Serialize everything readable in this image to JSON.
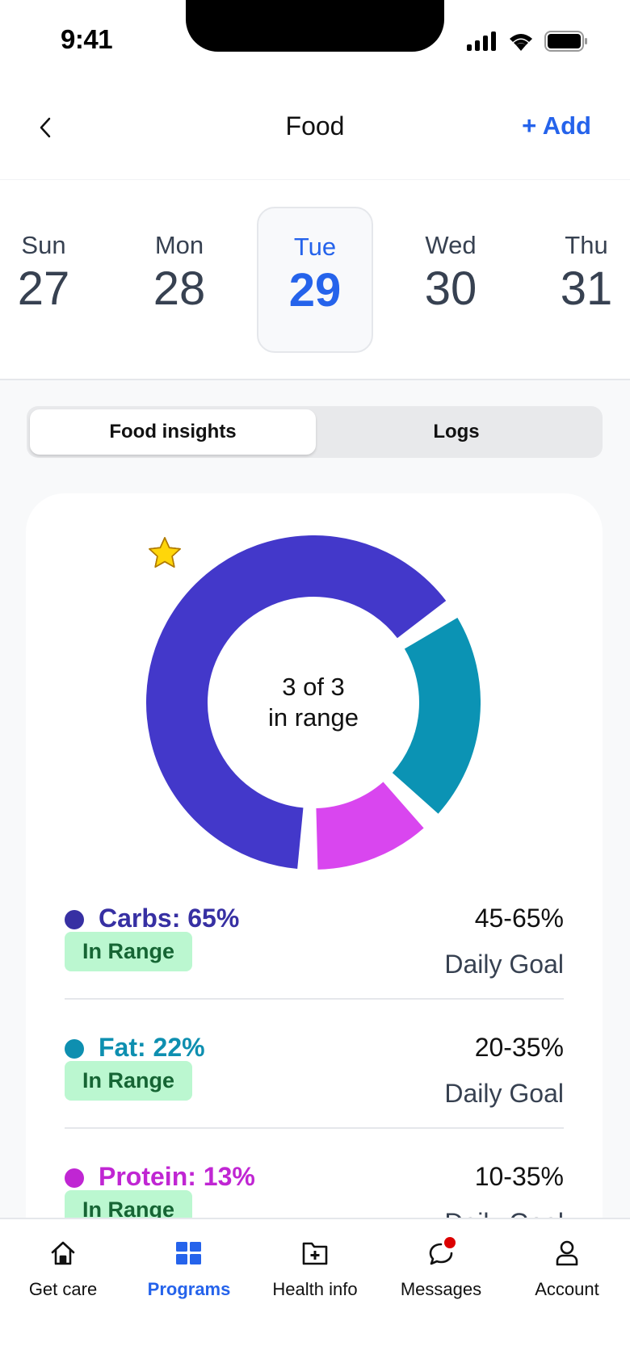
{
  "status_bar": {
    "time": "9:41"
  },
  "header": {
    "title": "Food",
    "add_label": "+ Add",
    "back_icon": "chevron-left-icon"
  },
  "dates": [
    {
      "day": "Sun",
      "num": "27",
      "selected": false
    },
    {
      "day": "Mon",
      "num": "28",
      "selected": false
    },
    {
      "day": "Tue",
      "num": "29",
      "selected": true
    },
    {
      "day": "Wed",
      "num": "30",
      "selected": false
    },
    {
      "day": "Thu",
      "num": "31",
      "selected": false
    }
  ],
  "segments": [
    {
      "label": "Food insights",
      "active": true
    },
    {
      "label": "Logs",
      "active": false
    }
  ],
  "summary": {
    "stars_filled": 3,
    "stars_total": 3,
    "line1": "3 of 3",
    "line2": "in range"
  },
  "macros": [
    {
      "name": "Carbs",
      "label": "Carbs: 65%",
      "percent": 65,
      "status": "In Range",
      "goal_range": "45-65%",
      "goal_label": "Daily Goal",
      "color": "#4338ca",
      "text_color": "#3730a3"
    },
    {
      "name": "Fat",
      "label": "Fat: 22%",
      "percent": 22,
      "status": "In Range",
      "goal_range": "20-35%",
      "goal_label": "Daily Goal",
      "color": "#0b93b4",
      "text_color": "#0e8fb0"
    },
    {
      "name": "Protein",
      "label": "Protein: 13%",
      "percent": 13,
      "status": "In Range",
      "goal_range": "10-35%",
      "goal_label": "Daily Goal",
      "color": "#d946ef",
      "text_color": "#c026d3"
    }
  ],
  "chart_data": {
    "type": "pie",
    "categories": [
      "Carbs",
      "Fat",
      "Protein"
    ],
    "values": [
      65,
      22,
      13
    ],
    "colors": [
      "#4338ca",
      "#0b93b4",
      "#d946ef"
    ],
    "title": "",
    "center_text": [
      "3 of 3",
      "in range"
    ]
  },
  "tab_bar": {
    "tabs": [
      {
        "label": "Get care",
        "icon": "home-icon",
        "active": false
      },
      {
        "label": "Programs",
        "icon": "grid-icon",
        "active": true
      },
      {
        "label": "Health info",
        "icon": "folder-plus-icon",
        "active": false
      },
      {
        "label": "Messages",
        "icon": "chat-bubble-icon",
        "active": false,
        "badge": true
      },
      {
        "label": "Account",
        "icon": "person-icon",
        "active": false
      }
    ]
  },
  "colors": {
    "accent": "#2563eb",
    "badge_bg": "#bbf7d0",
    "badge_text": "#166534",
    "notification": "#dc0000"
  }
}
